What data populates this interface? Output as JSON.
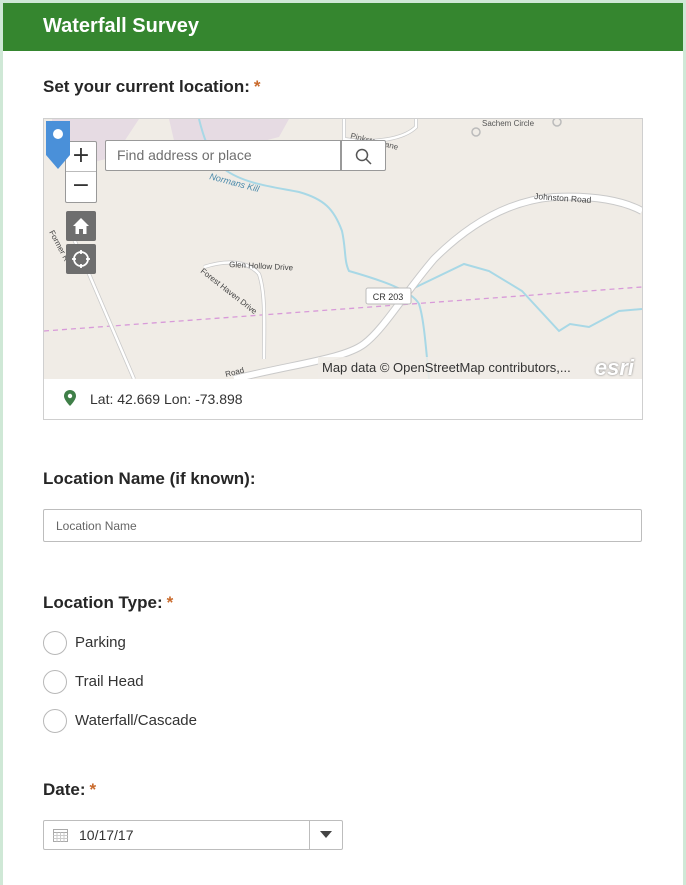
{
  "header": {
    "title": "Waterfall Survey"
  },
  "location_question": {
    "label": "Set your current location:",
    "required_mark": "*",
    "map": {
      "search_placeholder": "Find address or place",
      "zoom_in": "+",
      "zoom_out": "−",
      "attribution": "Map data © OpenStreetMap contributors,...",
      "logo": "esri",
      "labels": {
        "pinkster_lane": "Pinkster Lane",
        "sachem_circle": "Sachem Circle",
        "normans_kill": "Normans Kill",
        "johnston_road": "Johnston Road",
        "glen_hollow": "Glen Hollow Drive",
        "forest_haven": "Forest Haven Drive",
        "former_road": "Former R",
        "cr203": "CR 203",
        "road": "Road"
      }
    },
    "coordinates": "Lat: 42.669 Lon: -73.898"
  },
  "location_name": {
    "label": "Location Name (if known):",
    "placeholder": "Location Name"
  },
  "location_type": {
    "label": "Location Type:",
    "required_mark": "*",
    "options": [
      "Parking",
      "Trail Head",
      "Waterfall/Cascade"
    ]
  },
  "date": {
    "label": "Date:",
    "required_mark": "*",
    "value": "10/17/17"
  },
  "colors": {
    "header": "#35862f",
    "required": "#c9692a",
    "pin": "#4a90d9"
  },
  "icons": [
    "search-icon",
    "home-icon",
    "locate-icon",
    "map-pin-icon",
    "location-pin-icon",
    "calendar-icon",
    "chevron-down-icon"
  ]
}
